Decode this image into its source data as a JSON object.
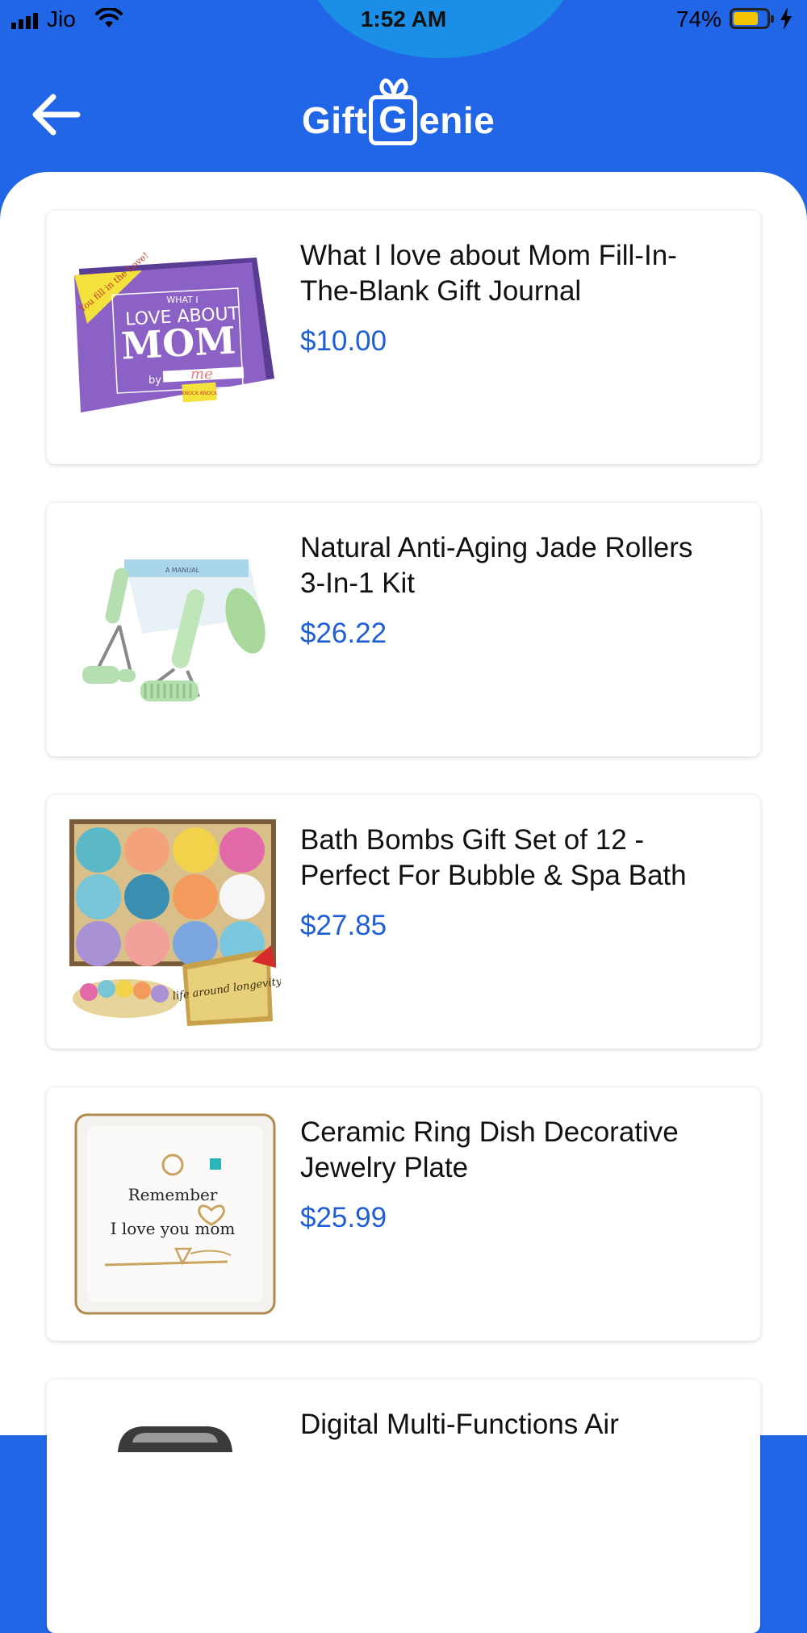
{
  "status_bar": {
    "carrier": "Jio",
    "time": "1:52 AM",
    "battery_percent": "74%",
    "battery_level": 0.74
  },
  "header": {
    "logo_left": "Gift",
    "logo_box_letter": "G",
    "logo_right": "enie",
    "back_icon": "arrow-left-icon"
  },
  "products": [
    {
      "title": "What I love about Mom Fill-In-The-Blank Gift Journal",
      "price": "$10.00",
      "image_text": {
        "banner": "You fill in the Love!",
        "line1": "WHAT I",
        "line2": "LOVE ABOUT",
        "line3": "MOM",
        "by": "by",
        "signature": "me",
        "brand": "KNOCK KNOCK"
      }
    },
    {
      "title": "Natural Anti-Aging Jade Rollers 3-In-1 Kit",
      "price": "$26.22",
      "image_text": {
        "box": "A MANUAL"
      }
    },
    {
      "title": "Bath Bombs Gift Set of 12 - Perfect For Bubble & Spa Bath",
      "price": "$27.85",
      "image_text": {
        "box": "life around longevity"
      }
    },
    {
      "title": "Ceramic Ring Dish Decorative Jewelry Plate",
      "price": "$25.99",
      "image_text": {
        "line1": "Remember",
        "line2": "I love you mom"
      }
    },
    {
      "title": "Digital Multi-Functions Air",
      "price": "",
      "image_text": {}
    }
  ],
  "colors": {
    "header_bg": "#2266e8",
    "notch": "#1b8fe6",
    "price": "#1f5fd6",
    "battery": "#f5c400"
  }
}
